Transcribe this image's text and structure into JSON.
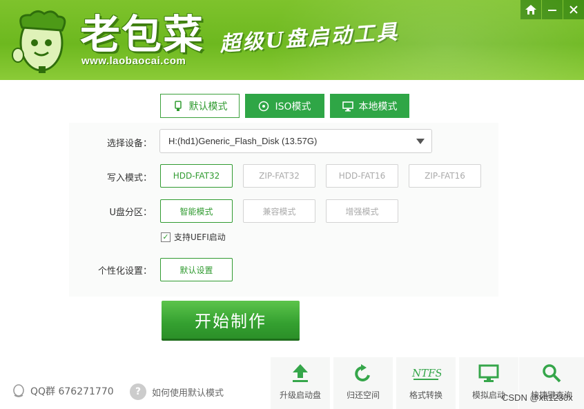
{
  "header": {
    "brand": "老包菜",
    "url": "www.laobaocai.com",
    "slogan": "超级U盘启动工具",
    "window_buttons": [
      "home-icon",
      "minimize-icon",
      "close-icon"
    ]
  },
  "tabs": [
    {
      "label": "默认模式",
      "icon": "usb-icon",
      "active": true
    },
    {
      "label": "ISO模式",
      "icon": "disc-icon",
      "active": false
    },
    {
      "label": "本地模式",
      "icon": "monitor-icon",
      "active": false
    }
  ],
  "device": {
    "label": "选择设备：",
    "value": "H:(hd1)Generic_Flash_Disk (13.57G)"
  },
  "write_mode": {
    "label": "写入模式：",
    "options": [
      "HDD-FAT32",
      "ZIP-FAT32",
      "HDD-FAT16",
      "ZIP-FAT16"
    ],
    "selected": "HDD-FAT32"
  },
  "partition": {
    "label": "U盘分区：",
    "options": [
      "智能模式",
      "兼容模式",
      "增强模式"
    ],
    "selected": "智能模式"
  },
  "uefi": {
    "label": "支持UEFI启动",
    "checked": true
  },
  "personal": {
    "label": "个性化设置：",
    "button": "默认设置"
  },
  "start_button": "开始制作",
  "footer": {
    "qq": "QQ群 676271770",
    "help": "如何使用默认模式",
    "tools": [
      {
        "label": "升级启动盘",
        "icon": "upload-icon"
      },
      {
        "label": "归还空间",
        "icon": "refresh-icon"
      },
      {
        "label": "格式转换",
        "icon": "ntfs-icon"
      },
      {
        "label": "模拟启动",
        "icon": "monitor-icon"
      },
      {
        "label": "快捷键查询",
        "icon": "search-icon"
      }
    ],
    "watermark": "CSDN @xtt1230x"
  },
  "colors": {
    "brand_green": "#6db81f",
    "accent_green": "#2f9a2f",
    "tab_green": "#2fa646"
  }
}
